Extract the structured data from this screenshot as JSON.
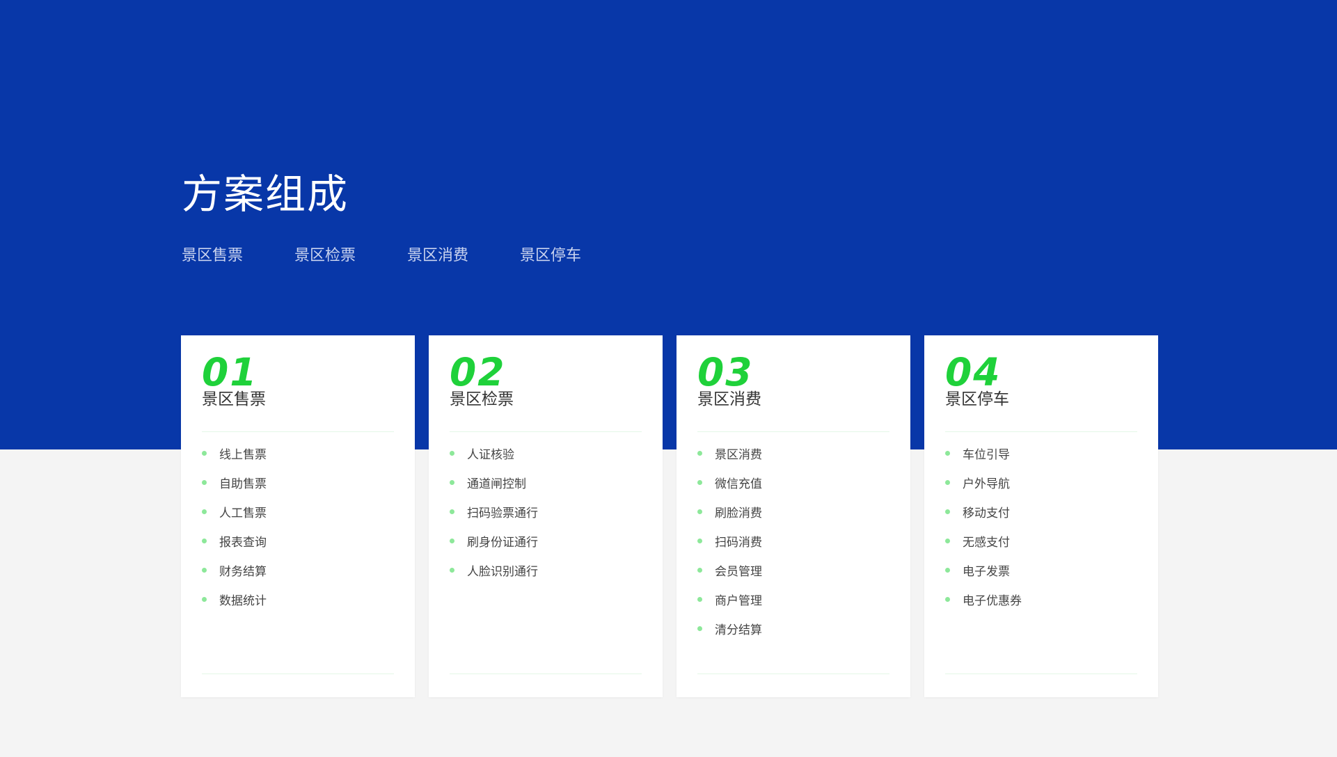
{
  "title": "方案组成",
  "tabs": [
    "景区售票",
    "景区检票",
    "景区消费",
    "景区停车"
  ],
  "colors": {
    "hero_background": "#0837a8",
    "accent_green": "#1fd13a",
    "page_background": "#f4f4f4"
  },
  "cards": [
    {
      "number": "01",
      "title": "景区售票",
      "items": [
        "线上售票",
        "自助售票",
        "人工售票",
        "报表查询",
        "财务结算",
        "数据统计"
      ]
    },
    {
      "number": "02",
      "title": "景区检票",
      "items": [
        "人证核验",
        "通道闸控制",
        "扫码验票通行",
        "刷身份证通行",
        "人脸识别通行"
      ]
    },
    {
      "number": "03",
      "title": "景区消费",
      "items": [
        "景区消费",
        "微信充值",
        "刷脸消费",
        "扫码消费",
        "会员管理",
        "商户管理",
        "清分结算"
      ]
    },
    {
      "number": "04",
      "title": "景区停车",
      "items": [
        "车位引导",
        "户外导航",
        "移动支付",
        "无感支付",
        "电子发票",
        "电子优惠券"
      ]
    }
  ]
}
